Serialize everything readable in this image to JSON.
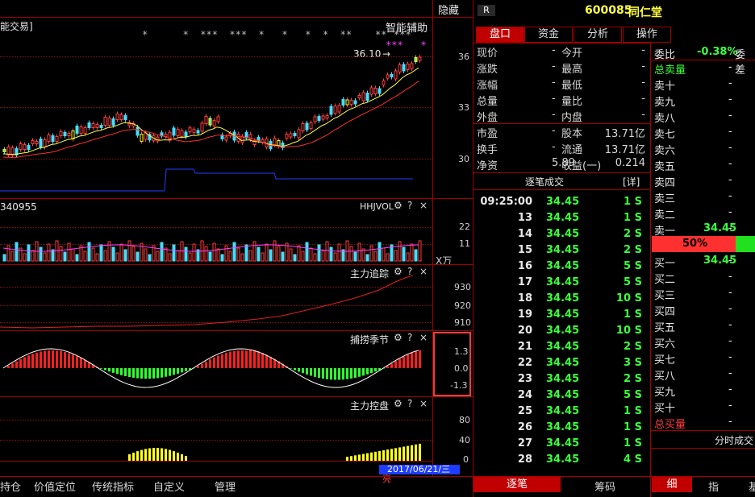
{
  "header": {
    "hide_label": "隐藏",
    "badge": "R",
    "stock_code": "600085",
    "stock_name": "同仁堂"
  },
  "kline": {
    "left_label": "能交易]",
    "right_label": "智能辅助",
    "high_label": "36.10",
    "axis": [
      "36",
      "33",
      "30"
    ],
    "stars": "*      *  ***  ***  *   *   *  *  **    **",
    "stars2": "***   *",
    "stars3": "***"
  },
  "volume": {
    "left_label": "340955",
    "title": "HHJVOL",
    "axis": [
      "22",
      "11"
    ],
    "unit": "X万"
  },
  "tracking": {
    "title": "主力追踪",
    "axis": [
      "930",
      "920",
      "910"
    ]
  },
  "season": {
    "title": "捕捞季节",
    "axis": [
      "1.3",
      "0.0",
      "-1.3"
    ]
  },
  "control": {
    "title": "主力控盘",
    "axis": [
      "80",
      "40",
      "0"
    ],
    "date": "2017/06/21/三",
    "date_suffix": "亮"
  },
  "panel_icons": {
    "gear": "⚙",
    "question": "?",
    "close": "×"
  },
  "bottom_tabs": [
    "持仓",
    "价值定位",
    "传统指标",
    "自定义",
    "管理"
  ],
  "right_tabs": [
    "盘口",
    "资金",
    "分析",
    "操作"
  ],
  "quote": {
    "rows": [
      {
        "l": "现价",
        "lv": "-",
        "r": "今开",
        "rv": "-"
      },
      {
        "l": "涨跌",
        "lv": "-",
        "r": "最高",
        "rv": "-"
      },
      {
        "l": "涨幅",
        "lv": "-",
        "r": "最低",
        "rv": "-"
      },
      {
        "l": "总量",
        "lv": "-",
        "r": "量比",
        "rv": "-"
      },
      {
        "l": "外盘",
        "lv": "-",
        "r": "内盘",
        "rv": "-"
      }
    ],
    "rows2": [
      {
        "l": "市盈",
        "lv": "-",
        "r": "股本",
        "rv": "13.71亿"
      },
      {
        "l": "换手",
        "lv": "-",
        "r": "流通",
        "rv": "13.71亿"
      },
      {
        "l": "净资",
        "lv": "5.89",
        "r": "收益(一)",
        "rv": "0.214"
      }
    ]
  },
  "trades": {
    "title": "逐笔成交",
    "detail": "[详]",
    "rows": [
      {
        "t": "09:25:00",
        "p": "34.45",
        "v": "1",
        "s": "S"
      },
      {
        "t": "13",
        "p": "34.45",
        "v": "1",
        "s": "S"
      },
      {
        "t": "14",
        "p": "34.45",
        "v": "2",
        "s": "S"
      },
      {
        "t": "15",
        "p": "34.45",
        "v": "2",
        "s": "S"
      },
      {
        "t": "16",
        "p": "34.45",
        "v": "5",
        "s": "S"
      },
      {
        "t": "17",
        "p": "34.45",
        "v": "5",
        "s": "S"
      },
      {
        "t": "18",
        "p": "34.45",
        "v": "10",
        "s": "S"
      },
      {
        "t": "19",
        "p": "34.45",
        "v": "1",
        "s": "S"
      },
      {
        "t": "20",
        "p": "34.45",
        "v": "10",
        "s": "S"
      },
      {
        "t": "21",
        "p": "34.45",
        "v": "2",
        "s": "S"
      },
      {
        "t": "22",
        "p": "34.45",
        "v": "3",
        "s": "S"
      },
      {
        "t": "23",
        "p": "34.45",
        "v": "2",
        "s": "S"
      },
      {
        "t": "24",
        "p": "34.45",
        "v": "5",
        "s": "S"
      },
      {
        "t": "25",
        "p": "34.45",
        "v": "1",
        "s": "S"
      },
      {
        "t": "26",
        "p": "34.45",
        "v": "1",
        "s": "S"
      },
      {
        "t": "27",
        "p": "34.45",
        "v": "1",
        "s": "S"
      },
      {
        "t": "28",
        "p": "34.45",
        "v": "4",
        "s": "S"
      }
    ],
    "tab_active": "逐笔",
    "tab_other": "筹码"
  },
  "orderbook": {
    "ratio_label": "委比",
    "ratio_value": "-0.38%",
    "diff_label": "委差",
    "total_sell": "总卖量",
    "sell": [
      "卖十",
      "卖九",
      "卖八",
      "卖七",
      "卖六",
      "卖五",
      "卖四",
      "卖三",
      "卖二",
      "卖一"
    ],
    "sell1_price": "34.45",
    "percent": "50%",
    "buy": [
      "买一",
      "买二",
      "买三",
      "买四",
      "买五",
      "买六",
      "买七",
      "买八",
      "买九",
      "买十"
    ],
    "buy1_price": "34.45",
    "total_buy": "总买量",
    "dash": "-",
    "footer": "分时成交",
    "tabs": [
      "细",
      "指",
      "基"
    ]
  }
}
